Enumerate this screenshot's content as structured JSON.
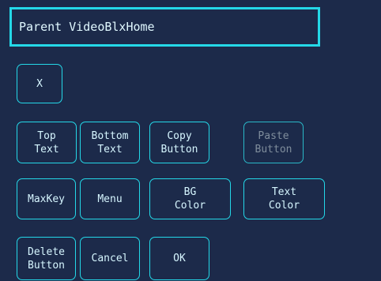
{
  "title": "Parent VideoBlxHome",
  "buttons": {
    "close": "X",
    "top_text": "Top\nText",
    "bottom_text": "Bottom\nText",
    "copy_button": "Copy\nButton",
    "paste_button": "Paste\nButton",
    "maxkey": "MaxKey",
    "menu": "Menu",
    "bg_color": "BG\nColor",
    "text_color": "Text\nColor",
    "delete_button": "Delete\nButton",
    "cancel": "Cancel",
    "ok": "OK"
  },
  "colors": {
    "background": "#1c2a4a",
    "accent": "#24d8e8",
    "text": "#d6f6ff",
    "disabled_text": "#7f8d9c"
  }
}
